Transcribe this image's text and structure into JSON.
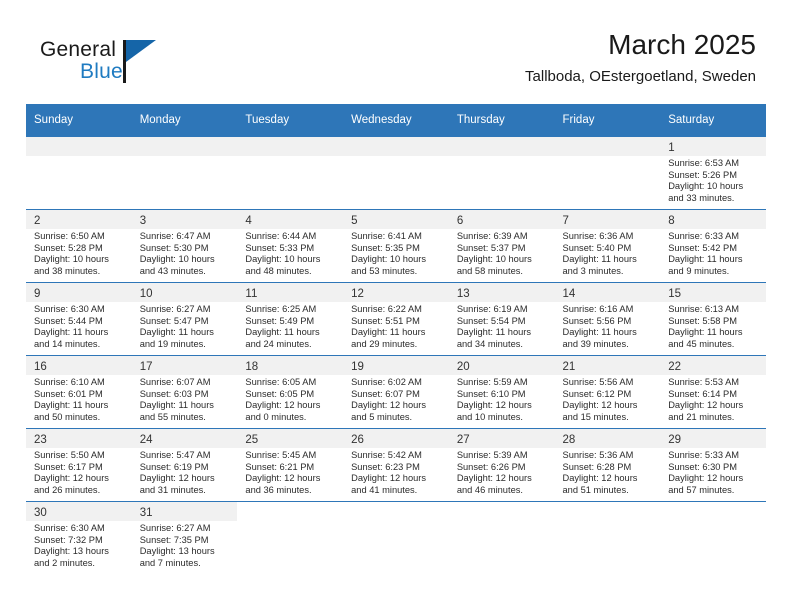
{
  "brand": {
    "word1": "General",
    "word2": "Blue",
    "logo_icon": "triangle-logo-icon"
  },
  "header": {
    "month_title": "March 2025",
    "location": "Tallboda, OEstergoetland, Sweden"
  },
  "colors": {
    "header_blue": "#2e76b8",
    "brand_blue": "#1f7bc1",
    "daynum_band": "#f1f1f1",
    "text": "#1a1a1a"
  },
  "weekday_headers": [
    "Sunday",
    "Monday",
    "Tuesday",
    "Wednesday",
    "Thursday",
    "Friday",
    "Saturday"
  ],
  "labels": {
    "sunrise_prefix": "Sunrise:",
    "sunset_prefix": "Sunset:",
    "daylight_prefix": "Daylight:"
  },
  "weeks": [
    [
      {
        "day": "",
        "sunrise": "",
        "sunset": "",
        "daylight_line1": "",
        "daylight_line2": ""
      },
      {
        "day": "",
        "sunrise": "",
        "sunset": "",
        "daylight_line1": "",
        "daylight_line2": ""
      },
      {
        "day": "",
        "sunrise": "",
        "sunset": "",
        "daylight_line1": "",
        "daylight_line2": ""
      },
      {
        "day": "",
        "sunrise": "",
        "sunset": "",
        "daylight_line1": "",
        "daylight_line2": ""
      },
      {
        "day": "",
        "sunrise": "",
        "sunset": "",
        "daylight_line1": "",
        "daylight_line2": ""
      },
      {
        "day": "",
        "sunrise": "",
        "sunset": "",
        "daylight_line1": "",
        "daylight_line2": ""
      },
      {
        "day": "1",
        "sunrise": "Sunrise: 6:53 AM",
        "sunset": "Sunset: 5:26 PM",
        "daylight_line1": "Daylight: 10 hours",
        "daylight_line2": "and 33 minutes."
      }
    ],
    [
      {
        "day": "2",
        "sunrise": "Sunrise: 6:50 AM",
        "sunset": "Sunset: 5:28 PM",
        "daylight_line1": "Daylight: 10 hours",
        "daylight_line2": "and 38 minutes."
      },
      {
        "day": "3",
        "sunrise": "Sunrise: 6:47 AM",
        "sunset": "Sunset: 5:30 PM",
        "daylight_line1": "Daylight: 10 hours",
        "daylight_line2": "and 43 minutes."
      },
      {
        "day": "4",
        "sunrise": "Sunrise: 6:44 AM",
        "sunset": "Sunset: 5:33 PM",
        "daylight_line1": "Daylight: 10 hours",
        "daylight_line2": "and 48 minutes."
      },
      {
        "day": "5",
        "sunrise": "Sunrise: 6:41 AM",
        "sunset": "Sunset: 5:35 PM",
        "daylight_line1": "Daylight: 10 hours",
        "daylight_line2": "and 53 minutes."
      },
      {
        "day": "6",
        "sunrise": "Sunrise: 6:39 AM",
        "sunset": "Sunset: 5:37 PM",
        "daylight_line1": "Daylight: 10 hours",
        "daylight_line2": "and 58 minutes."
      },
      {
        "day": "7",
        "sunrise": "Sunrise: 6:36 AM",
        "sunset": "Sunset: 5:40 PM",
        "daylight_line1": "Daylight: 11 hours",
        "daylight_line2": "and 3 minutes."
      },
      {
        "day": "8",
        "sunrise": "Sunrise: 6:33 AM",
        "sunset": "Sunset: 5:42 PM",
        "daylight_line1": "Daylight: 11 hours",
        "daylight_line2": "and 9 minutes."
      }
    ],
    [
      {
        "day": "9",
        "sunrise": "Sunrise: 6:30 AM",
        "sunset": "Sunset: 5:44 PM",
        "daylight_line1": "Daylight: 11 hours",
        "daylight_line2": "and 14 minutes."
      },
      {
        "day": "10",
        "sunrise": "Sunrise: 6:27 AM",
        "sunset": "Sunset: 5:47 PM",
        "daylight_line1": "Daylight: 11 hours",
        "daylight_line2": "and 19 minutes."
      },
      {
        "day": "11",
        "sunrise": "Sunrise: 6:25 AM",
        "sunset": "Sunset: 5:49 PM",
        "daylight_line1": "Daylight: 11 hours",
        "daylight_line2": "and 24 minutes."
      },
      {
        "day": "12",
        "sunrise": "Sunrise: 6:22 AM",
        "sunset": "Sunset: 5:51 PM",
        "daylight_line1": "Daylight: 11 hours",
        "daylight_line2": "and 29 minutes."
      },
      {
        "day": "13",
        "sunrise": "Sunrise: 6:19 AM",
        "sunset": "Sunset: 5:54 PM",
        "daylight_line1": "Daylight: 11 hours",
        "daylight_line2": "and 34 minutes."
      },
      {
        "day": "14",
        "sunrise": "Sunrise: 6:16 AM",
        "sunset": "Sunset: 5:56 PM",
        "daylight_line1": "Daylight: 11 hours",
        "daylight_line2": "and 39 minutes."
      },
      {
        "day": "15",
        "sunrise": "Sunrise: 6:13 AM",
        "sunset": "Sunset: 5:58 PM",
        "daylight_line1": "Daylight: 11 hours",
        "daylight_line2": "and 45 minutes."
      }
    ],
    [
      {
        "day": "16",
        "sunrise": "Sunrise: 6:10 AM",
        "sunset": "Sunset: 6:01 PM",
        "daylight_line1": "Daylight: 11 hours",
        "daylight_line2": "and 50 minutes."
      },
      {
        "day": "17",
        "sunrise": "Sunrise: 6:07 AM",
        "sunset": "Sunset: 6:03 PM",
        "daylight_line1": "Daylight: 11 hours",
        "daylight_line2": "and 55 minutes."
      },
      {
        "day": "18",
        "sunrise": "Sunrise: 6:05 AM",
        "sunset": "Sunset: 6:05 PM",
        "daylight_line1": "Daylight: 12 hours",
        "daylight_line2": "and 0 minutes."
      },
      {
        "day": "19",
        "sunrise": "Sunrise: 6:02 AM",
        "sunset": "Sunset: 6:07 PM",
        "daylight_line1": "Daylight: 12 hours",
        "daylight_line2": "and 5 minutes."
      },
      {
        "day": "20",
        "sunrise": "Sunrise: 5:59 AM",
        "sunset": "Sunset: 6:10 PM",
        "daylight_line1": "Daylight: 12 hours",
        "daylight_line2": "and 10 minutes."
      },
      {
        "day": "21",
        "sunrise": "Sunrise: 5:56 AM",
        "sunset": "Sunset: 6:12 PM",
        "daylight_line1": "Daylight: 12 hours",
        "daylight_line2": "and 15 minutes."
      },
      {
        "day": "22",
        "sunrise": "Sunrise: 5:53 AM",
        "sunset": "Sunset: 6:14 PM",
        "daylight_line1": "Daylight: 12 hours",
        "daylight_line2": "and 21 minutes."
      }
    ],
    [
      {
        "day": "23",
        "sunrise": "Sunrise: 5:50 AM",
        "sunset": "Sunset: 6:17 PM",
        "daylight_line1": "Daylight: 12 hours",
        "daylight_line2": "and 26 minutes."
      },
      {
        "day": "24",
        "sunrise": "Sunrise: 5:47 AM",
        "sunset": "Sunset: 6:19 PM",
        "daylight_line1": "Daylight: 12 hours",
        "daylight_line2": "and 31 minutes."
      },
      {
        "day": "25",
        "sunrise": "Sunrise: 5:45 AM",
        "sunset": "Sunset: 6:21 PM",
        "daylight_line1": "Daylight: 12 hours",
        "daylight_line2": "and 36 minutes."
      },
      {
        "day": "26",
        "sunrise": "Sunrise: 5:42 AM",
        "sunset": "Sunset: 6:23 PM",
        "daylight_line1": "Daylight: 12 hours",
        "daylight_line2": "and 41 minutes."
      },
      {
        "day": "27",
        "sunrise": "Sunrise: 5:39 AM",
        "sunset": "Sunset: 6:26 PM",
        "daylight_line1": "Daylight: 12 hours",
        "daylight_line2": "and 46 minutes."
      },
      {
        "day": "28",
        "sunrise": "Sunrise: 5:36 AM",
        "sunset": "Sunset: 6:28 PM",
        "daylight_line1": "Daylight: 12 hours",
        "daylight_line2": "and 51 minutes."
      },
      {
        "day": "29",
        "sunrise": "Sunrise: 5:33 AM",
        "sunset": "Sunset: 6:30 PM",
        "daylight_line1": "Daylight: 12 hours",
        "daylight_line2": "and 57 minutes."
      }
    ],
    [
      {
        "day": "30",
        "sunrise": "Sunrise: 6:30 AM",
        "sunset": "Sunset: 7:32 PM",
        "daylight_line1": "Daylight: 13 hours",
        "daylight_line2": "and 2 minutes."
      },
      {
        "day": "31",
        "sunrise": "Sunrise: 6:27 AM",
        "sunset": "Sunset: 7:35 PM",
        "daylight_line1": "Daylight: 13 hours",
        "daylight_line2": "and 7 minutes."
      },
      {
        "day": "",
        "sunrise": "",
        "sunset": "",
        "daylight_line1": "",
        "daylight_line2": ""
      },
      {
        "day": "",
        "sunrise": "",
        "sunset": "",
        "daylight_line1": "",
        "daylight_line2": ""
      },
      {
        "day": "",
        "sunrise": "",
        "sunset": "",
        "daylight_line1": "",
        "daylight_line2": ""
      },
      {
        "day": "",
        "sunrise": "",
        "sunset": "",
        "daylight_line1": "",
        "daylight_line2": ""
      },
      {
        "day": "",
        "sunrise": "",
        "sunset": "",
        "daylight_line1": "",
        "daylight_line2": ""
      }
    ]
  ]
}
